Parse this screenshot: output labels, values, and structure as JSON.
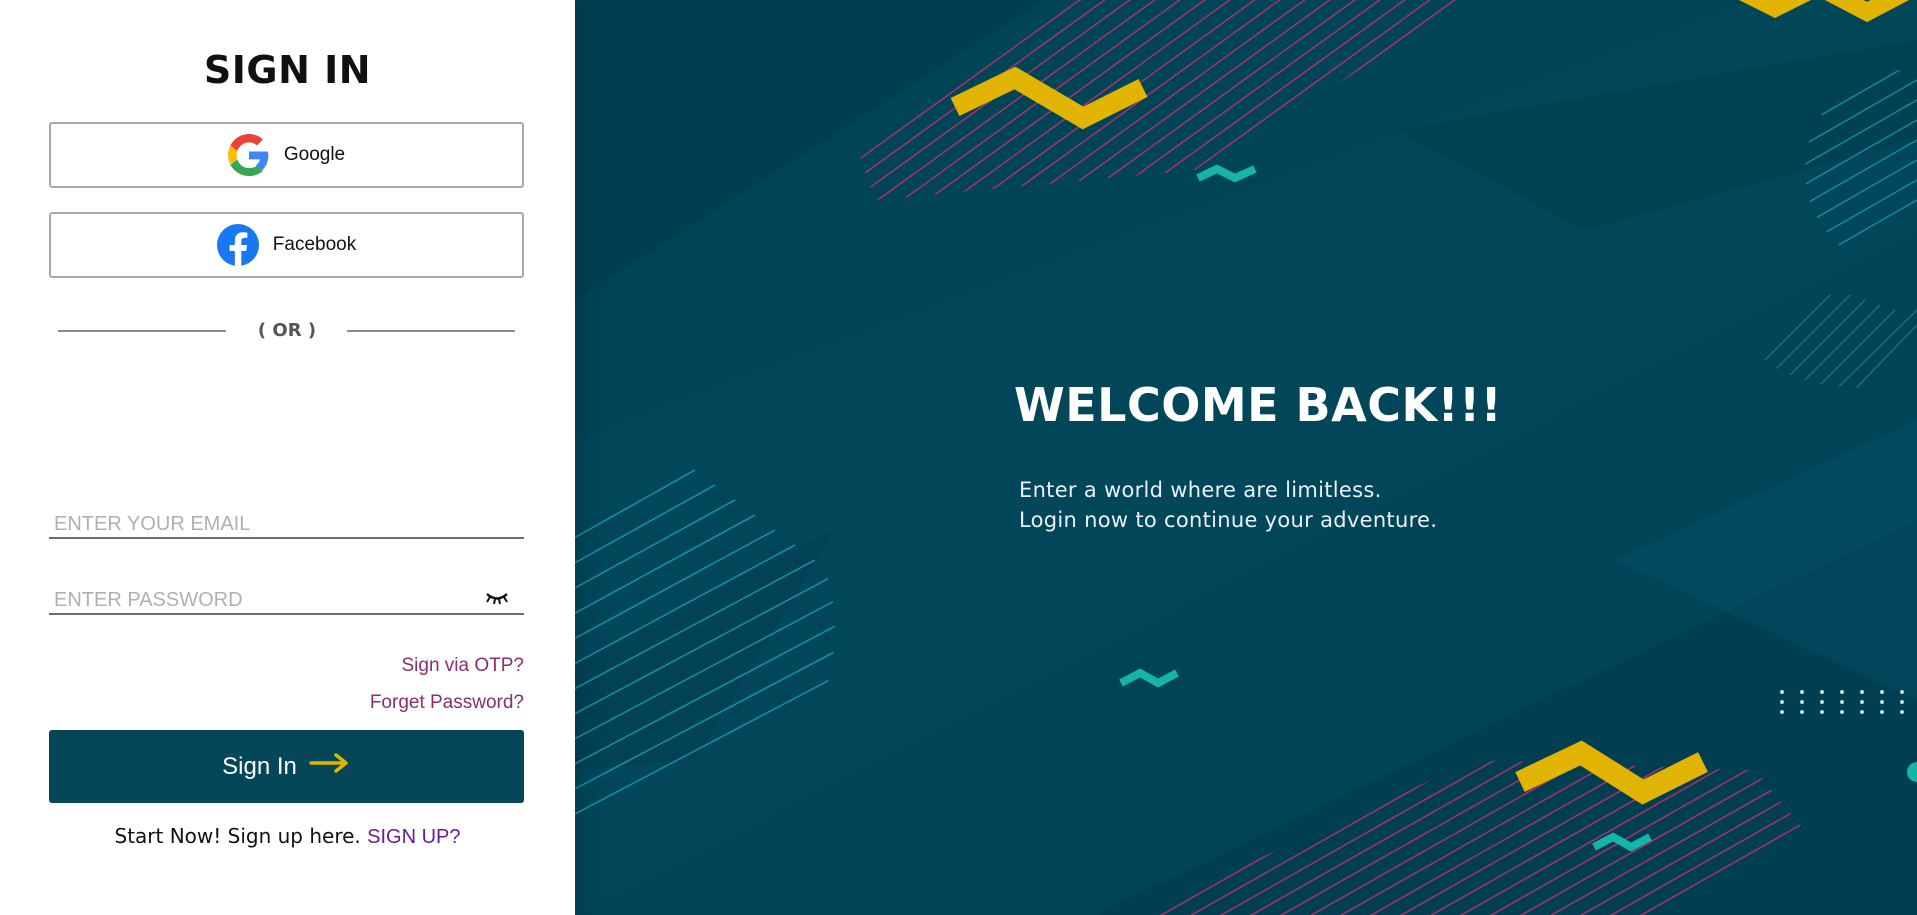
{
  "signin": {
    "title": "SIGN IN",
    "google_label": "Google",
    "facebook_label": "Facebook",
    "divider_text": "( OR )",
    "email_placeholder": "ENTER YOUR EMAIL",
    "password_placeholder": "ENTER PASSWORD",
    "otp_link": "Sign via OTP?",
    "forget_link": "Forget Password?",
    "submit_label": "Sign In",
    "signup_prompt": "Start Now! Sign up here.",
    "signup_link": "SIGN UP?"
  },
  "hero": {
    "heading": "WELCOME BACK!!!",
    "line1": "Enter a world where are limitless.",
    "line2": "Login now to continue your adventure."
  },
  "icons": {
    "google": "google-icon",
    "facebook": "facebook-icon",
    "eye": "eye-closed-icon",
    "arrow": "arrow-right-icon"
  },
  "colors": {
    "primary": "#064659",
    "hero_bg": "#004457",
    "accent_yellow": "#e0b400",
    "accent_teal": "#14b5a8",
    "accent_pink": "#c0306a",
    "link": "#8a2e6e",
    "signup_link": "#6a1b9a"
  }
}
